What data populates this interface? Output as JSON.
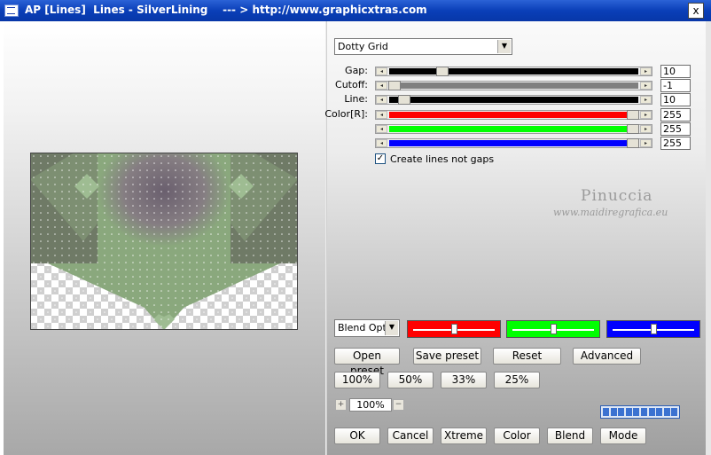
{
  "window": {
    "title": "AP [Lines]  Lines - SilverLining    --- > http://www.graphicxtras.com",
    "close_label": "x"
  },
  "mode_select": {
    "value": "Dotty Grid"
  },
  "sliders": [
    {
      "label": "Gap:",
      "value": "10",
      "level": 0.2,
      "color": "#000000"
    },
    {
      "label": "Cutoff:",
      "value": "-1",
      "level": 0.0,
      "color": "#808080"
    },
    {
      "label": "Line:",
      "value": "10",
      "level": 0.04,
      "color": "#000000"
    },
    {
      "label": "Color[R]:",
      "value": "255",
      "level": 1.0,
      "color": "#ff0000"
    },
    {
      "label": "",
      "value": "255",
      "level": 1.0,
      "color": "#00ff00"
    },
    {
      "label": "",
      "value": "255",
      "level": 1.0,
      "color": "#0000ff"
    }
  ],
  "checkbox": {
    "label": "Create lines not gaps",
    "checked": true,
    "mark": "✓"
  },
  "watermark": {
    "name": "Pinuccia",
    "url": "www.maidiregrafica.eu"
  },
  "blend_select": {
    "value": "Blend Optio"
  },
  "color_swatches": [
    {
      "color": "#ff0000",
      "level": 0.5,
      "name": "red-swatch-slider"
    },
    {
      "color": "#00ff00",
      "level": 0.5,
      "name": "green-swatch-slider"
    },
    {
      "color": "#0000ff",
      "level": 0.5,
      "name": "blue-swatch-slider"
    }
  ],
  "preset_buttons": {
    "open": "Open preset",
    "save": "Save preset",
    "reset": "Reset",
    "advanced": "Advanced"
  },
  "zoom_buttons": [
    "100%",
    "50%",
    "33%",
    "25%"
  ],
  "zoom": {
    "plus": "+",
    "value": "100%",
    "minus": "−"
  },
  "progress": {
    "segments": 10,
    "filled": 10
  },
  "bottom_buttons": [
    "OK",
    "Cancel",
    "Xtreme",
    "Color",
    "Blend",
    "Mode"
  ],
  "colors": {
    "title_bar": "#0a3fb8",
    "preview_green": "#8aa87d",
    "preview_purple": "#6e6470"
  }
}
